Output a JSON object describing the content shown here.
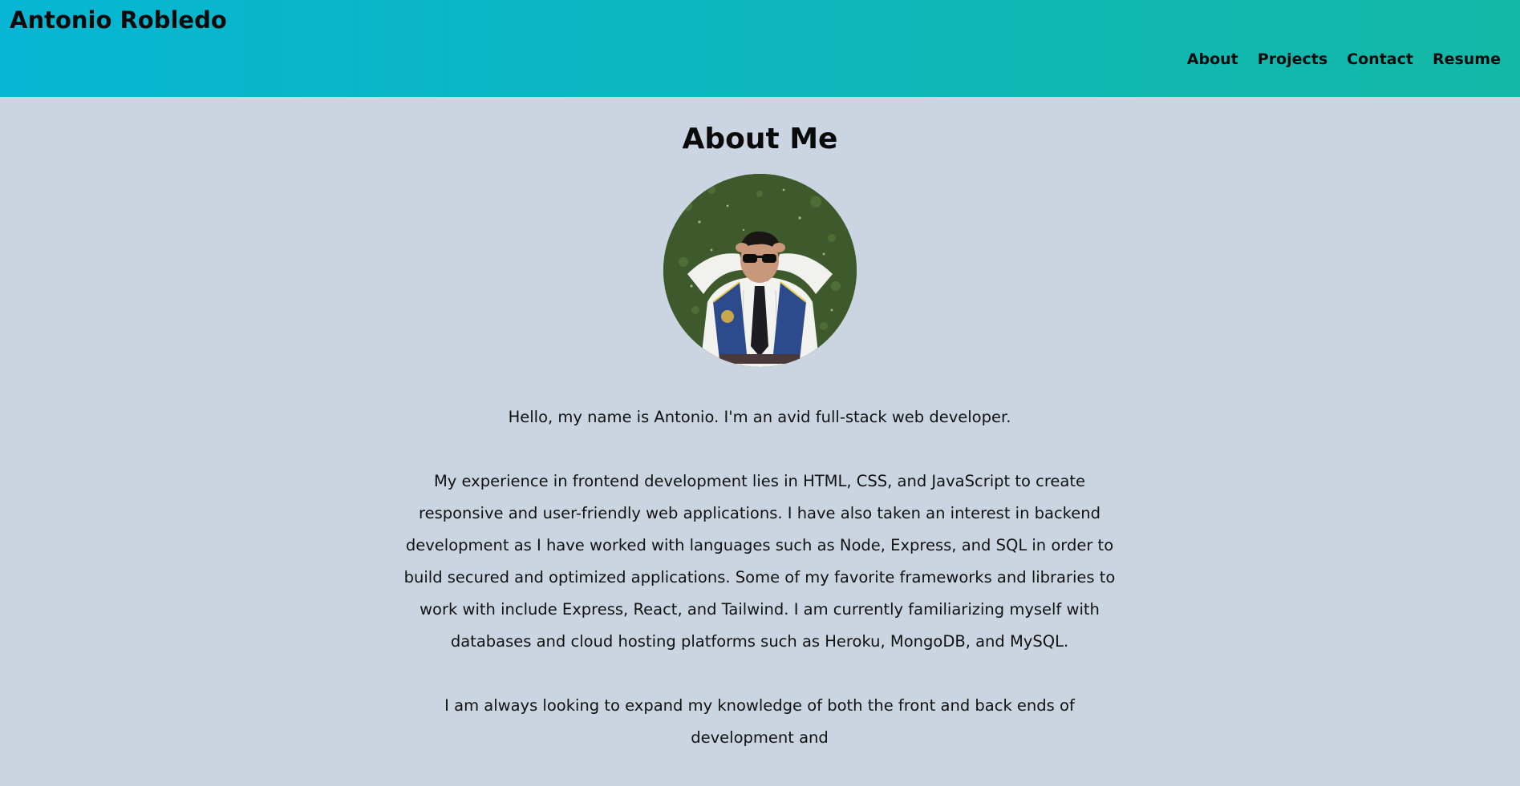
{
  "header": {
    "site_name": "Antonio Robledo",
    "nav": [
      "About",
      "Projects",
      "Contact",
      "Resume"
    ]
  },
  "about": {
    "title": "About Me",
    "paragraphs": [
      "Hello, my name is Antonio. I'm an avid full-stack web developer.",
      "My experience in frontend development lies in HTML, CSS, and JavaScript to create responsive and user-friendly web applications. I have also taken an interest in backend development as I have worked with languages such as Node, Express, and SQL in order to build secured and optimized applications. Some of my favorite frameworks and libraries to work with include Express, React, and Tailwind. I am currently familiarizing myself with databases and cloud hosting platforms such as Heroku, MongoDB, and MySQL.",
      "I am always looking to expand my knowledge of both the front and back ends of development and"
    ]
  },
  "colors": {
    "header_gradient_start": "#06b6d4",
    "header_gradient_end": "#14b8a6",
    "page_background": "#cbd5e1"
  }
}
